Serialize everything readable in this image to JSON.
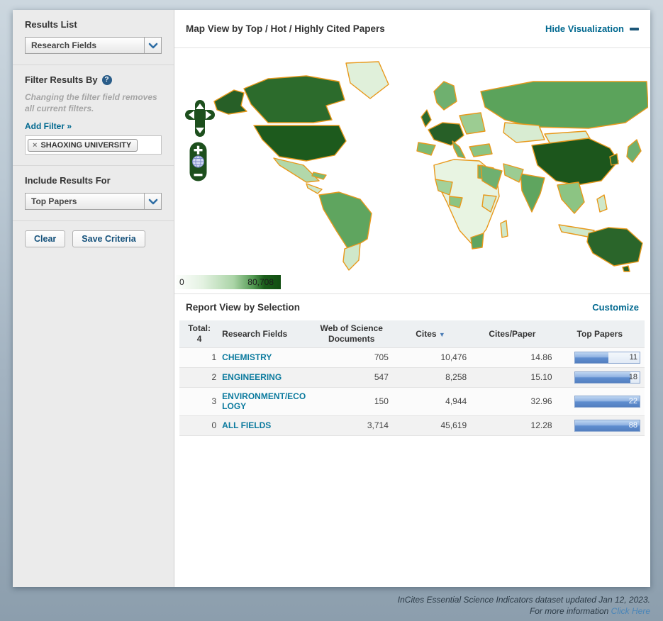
{
  "sidebar": {
    "results_list": {
      "heading": "Results List",
      "dropdown_value": "Research Fields"
    },
    "filter_by": {
      "heading": "Filter Results By",
      "help_label": "?",
      "note": "Changing the filter field removes all current filters.",
      "add_filter": "Add Filter »",
      "tag": {
        "remove": "×",
        "label": "SHAOXING UNIVERSITY"
      }
    },
    "include_for": {
      "heading": "Include Results For",
      "dropdown_value": "Top Papers"
    },
    "actions": {
      "clear": "Clear",
      "save": "Save Criteria"
    }
  },
  "map": {
    "title": "Map View by Top / Hot / Highly Cited Papers",
    "hide_link": "Hide Visualization",
    "controls": {
      "zoom_in": "+",
      "zoom_out": "−"
    },
    "legend": {
      "min": "0",
      "max": "80,708"
    }
  },
  "report": {
    "title": "Report View by Selection",
    "customize": "Customize",
    "header": {
      "total_label": "Total:",
      "total_value": "4",
      "research_fields": "Research Fields",
      "docs": "Web of Science Documents",
      "cites": "Cites",
      "cites_per_paper": "Cites/Paper",
      "top_papers": "Top Papers"
    },
    "rows": [
      {
        "rank": "1",
        "field": "CHEMISTRY",
        "docs": "705",
        "cites": "10,476",
        "cites_per_paper": "14.86",
        "top_papers": "11",
        "bar_pct": 52
      },
      {
        "rank": "2",
        "field": "ENGINEERING",
        "docs": "547",
        "cites": "8,258",
        "cites_per_paper": "15.10",
        "top_papers": "18",
        "bar_pct": 86
      },
      {
        "rank": "3",
        "field": "ENVIRONMENT/ECOLOGY",
        "docs": "150",
        "cites": "4,944",
        "cites_per_paper": "32.96",
        "top_papers": "22",
        "bar_pct": 100
      },
      {
        "rank": "0",
        "field": "ALL FIELDS",
        "docs": "3,714",
        "cites": "45,619",
        "cites_per_paper": "12.28",
        "top_papers": "88",
        "bar_pct": 100
      }
    ]
  },
  "footer": {
    "line1": "InCites Essential Science Indicators dataset updated Jan 12, 2023.",
    "line2_text": "For more information",
    "line2_link": "Click Here"
  },
  "colors": {
    "accent_teal": "#00688f",
    "cites_sort_blue": "#5b8ec4",
    "bar_blue": "#537fc0",
    "map_border_orange": "#e8991c",
    "map_dark_green": "#1d5a1d",
    "map_mid_green": "#5ba35b",
    "map_light_green": "#cfe8ca",
    "control_green": "#1d4f1d"
  }
}
